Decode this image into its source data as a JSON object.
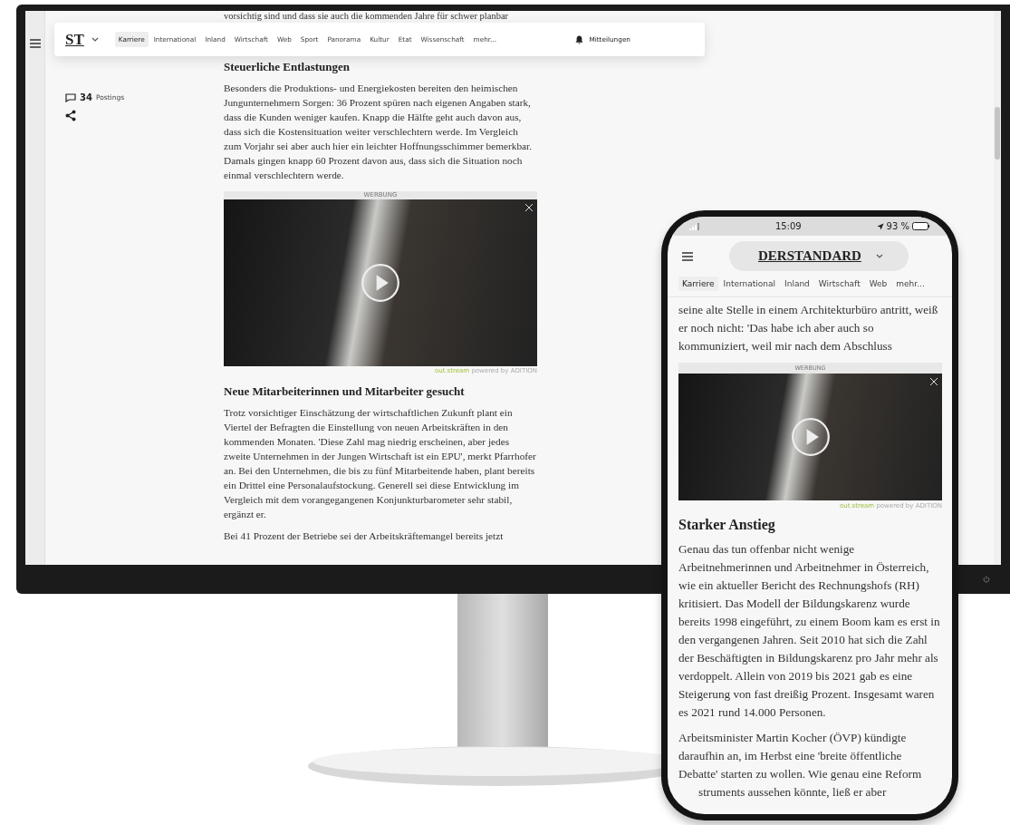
{
  "desktop": {
    "nav": {
      "logo": "ST",
      "items": [
        {
          "label": "Karriere",
          "selected": true
        },
        {
          "label": "International",
          "selected": false
        },
        {
          "label": "Inland",
          "selected": false
        },
        {
          "label": "Wirtschaft",
          "selected": false
        },
        {
          "label": "Web",
          "selected": false
        },
        {
          "label": "Sport",
          "selected": false
        },
        {
          "label": "Panorama",
          "selected": false
        },
        {
          "label": "Kultur",
          "selected": false
        },
        {
          "label": "Etat",
          "selected": false
        },
        {
          "label": "Wissenschaft",
          "selected": false
        },
        {
          "label": "mehr...",
          "selected": false
        }
      ],
      "notifications": "Mitteilungen"
    },
    "postings": {
      "count": "34",
      "label": "Postings"
    },
    "blocks": [
      {
        "kind": "cut",
        "text": "vorsichtig sind und dass sie auch die kommenden Jahre für schwer planbar"
      },
      {
        "kind": "heading",
        "text": "Steuerliche Entlastungen"
      },
      {
        "kind": "paragraph",
        "text": "Besonders die Produktions- und Energiekosten bereiten den heimischen Jungunternehmern Sorgen: 36 Prozent spüren nach eigenen Angaben stark, dass die Kunden weniger kaufen. Knapp die Hälfte geht auch davon aus, dass sich die Kostensituation weiter verschlechtern werde. Im Vergleich zum Vorjahr sei aber auch hier ein leichter Hoffnungsschimmer bemerkbar. Damals gingen knapp 60 Prozent davon aus, dass sich die Situation noch einmal verschlechtern werde."
      },
      {
        "kind": "ad",
        "label": "WERBUNG",
        "brand": "out.stream",
        "credit": "powered by ADITION"
      },
      {
        "kind": "heading",
        "text": "Neue Mitarbeiterinnen und Mitarbeiter gesucht"
      },
      {
        "kind": "paragraph",
        "text": "Trotz vorsichtiger Einschätzung der wirtschaftlichen Zukunft plant ein Viertel der Befragten die Einstellung von neuen Arbeitskräften in den kommenden Monaten. 'Diese Zahl mag niedrig erscheinen, aber jedes zweite Unternehmen in der Jungen Wirtschaft ist ein EPU', merkt Pfarrhofer an. Bei den Unternehmen, die bis zu fünf Mitarbeitende haben, plant bereits ein Drittel eine Personalaufstockung. Generell sei diese Entwicklung im Vergleich mit dem vorangegangenen Konjunkturbarometer sehr stabil, ergänzt er."
      },
      {
        "kind": "paragraph",
        "text": "Bei 41 Prozent der Betriebe sei der Arbeitskräftemangel bereits jetzt"
      }
    ]
  },
  "phone": {
    "status": {
      "time": "15:09",
      "battery": "93 %"
    },
    "logo": "DERSTANDARD",
    "nav": [
      {
        "label": "Karriere",
        "selected": true
      },
      {
        "label": "International",
        "selected": false
      },
      {
        "label": "Inland",
        "selected": false
      },
      {
        "label": "Wirtschaft",
        "selected": false
      },
      {
        "label": "Web",
        "selected": false
      },
      {
        "label": "mehr...",
        "selected": false
      }
    ],
    "blocks": [
      {
        "kind": "paragraph",
        "text": "seine alte Stelle in einem Architekturbüro antritt, weiß er noch nicht: 'Das habe ich aber auch so kommuniziert, weil mir nach dem Abschluss"
      },
      {
        "kind": "ad",
        "label": "WERBUNG",
        "brand": "out.stream",
        "credit": "powered by ADITION"
      },
      {
        "kind": "heading",
        "text": "Starker Anstieg"
      },
      {
        "kind": "paragraph",
        "text": "Genau das tun offenbar nicht wenige Arbeitnehmerinnen und Arbeitnehmer in Österreich, wie ein aktueller Bericht des Rechnungshofs (RH) kritisiert. Das Modell der Bildungskarenz wurde bereits 1998 eingeführt, zu einem Boom kam es erst in den vergangenen Jahren. Seit 2010 hat sich die Zahl der Beschäftigten in Bildungskarenz pro Jahr mehr als verdoppelt. Allein von 2019 bis 2021 gab es eine Steigerung von fast dreißig Prozent. Insgesamt waren es 2021 rund 14.000 Personen."
      },
      {
        "kind": "paragraph",
        "text": "Arbeitsminister Martin Kocher (ÖVP) kündigte daraufhin an, im Herbst eine 'breite öffentliche Debatte' starten zu wollen. Wie genau eine Reform"
      },
      {
        "kind": "cut",
        "text": "struments aussehen könnte, ließ er aber"
      }
    ]
  }
}
